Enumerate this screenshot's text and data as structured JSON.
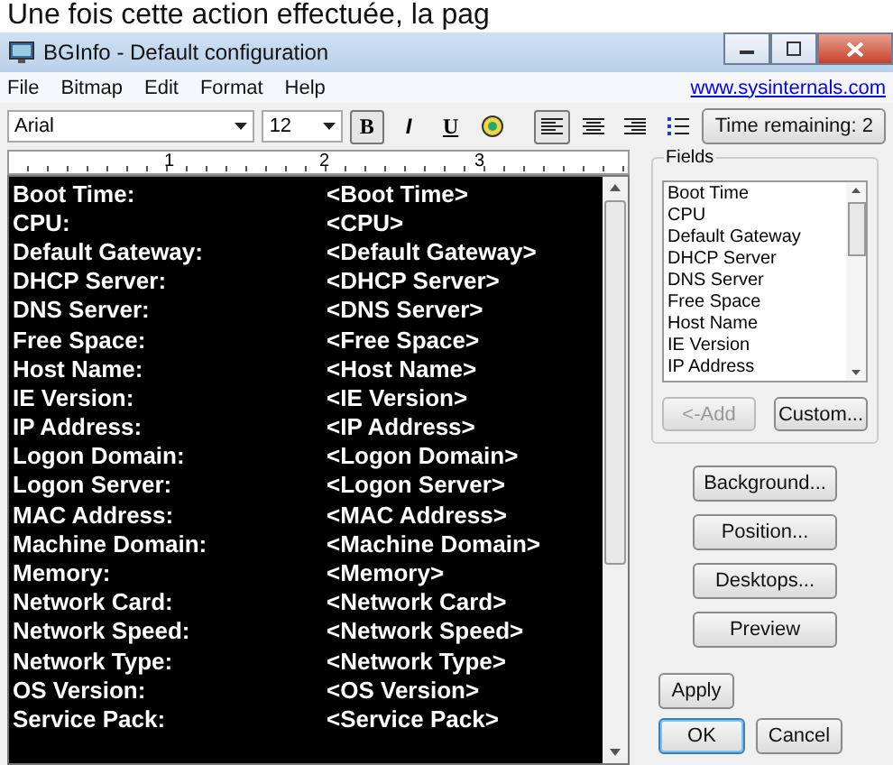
{
  "page_heading": "Une fois cette action effectuée, la pag",
  "window": {
    "title": "BGInfo - Default configuration"
  },
  "menu": [
    "File",
    "Bitmap",
    "Edit",
    "Format",
    "Help"
  ],
  "menu_link": "www.sysinternals.com",
  "toolbar": {
    "font": "Arial",
    "size": "12",
    "format_buttons": [
      {
        "kind": "bold",
        "label": "B",
        "selected": true
      },
      {
        "kind": "italic",
        "label": "I",
        "selected": false
      },
      {
        "kind": "underline",
        "label": "U",
        "selected": false
      },
      {
        "kind": "picture",
        "selected": false
      }
    ],
    "align_buttons": [
      {
        "kind": "left",
        "selected": true
      },
      {
        "kind": "center",
        "selected": false
      },
      {
        "kind": "right",
        "selected": false
      },
      {
        "kind": "bullets",
        "selected": false
      }
    ],
    "timer": "Time remaining: 2"
  },
  "ruler": [
    "1",
    "2",
    "3"
  ],
  "editor_rows": [
    {
      "label": "Boot Time:",
      "field": "<Boot Time>"
    },
    {
      "label": "CPU:",
      "field": "<CPU>"
    },
    {
      "label": "Default Gateway:",
      "field": "<Default Gateway>"
    },
    {
      "label": "DHCP Server:",
      "field": "<DHCP Server>"
    },
    {
      "label": "DNS Server:",
      "field": "<DNS Server>"
    },
    {
      "label": "Free Space:",
      "field": "<Free Space>"
    },
    {
      "label": "Host Name:",
      "field": "<Host Name>"
    },
    {
      "label": "IE Version:",
      "field": "<IE Version>"
    },
    {
      "label": "IP Address:",
      "field": "<IP Address>"
    },
    {
      "label": "Logon Domain:",
      "field": "<Logon Domain>"
    },
    {
      "label": "Logon Server:",
      "field": "<Logon Server>"
    },
    {
      "label": "MAC Address:",
      "field": "<MAC Address>"
    },
    {
      "label": "Machine Domain:",
      "field": "<Machine Domain>"
    },
    {
      "label": "Memory:",
      "field": "<Memory>"
    },
    {
      "label": "Network Card:",
      "field": "<Network Card>"
    },
    {
      "label": "Network Speed:",
      "field": "<Network Speed>"
    },
    {
      "label": "Network Type:",
      "field": "<Network Type>"
    },
    {
      "label": "OS Version:",
      "field": "<OS Version>"
    },
    {
      "label": "Service Pack:",
      "field": "<Service Pack>"
    }
  ],
  "fields": {
    "title": "Fields",
    "items": [
      "Boot Time",
      "CPU",
      "Default Gateway",
      "DHCP Server",
      "DNS Server",
      "Free Space",
      "Host Name",
      "IE Version",
      "IP Address"
    ],
    "buttons": [
      {
        "label": "<-Add",
        "disabled": true
      },
      {
        "label": "Custom...",
        "disabled": false
      }
    ]
  },
  "side_buttons": [
    "Background...",
    "Position...",
    "Desktops...",
    "Preview"
  ],
  "apply": "Apply",
  "dialog_buttons": [
    {
      "label": "OK",
      "default": true
    },
    {
      "label": "Cancel",
      "default": false
    }
  ]
}
